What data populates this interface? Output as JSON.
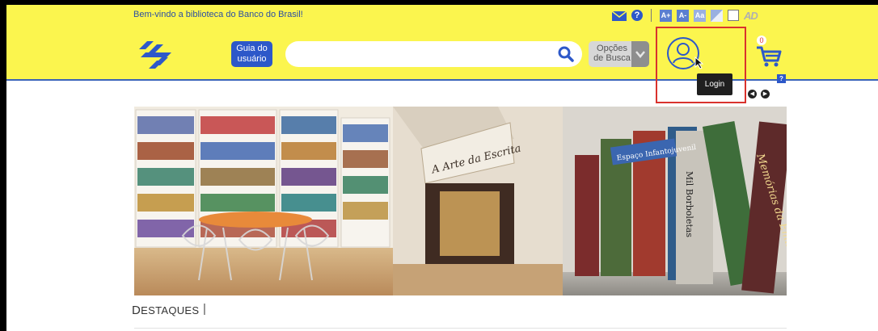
{
  "header": {
    "welcome_text": "Bem-vindo a biblioteca do Banco do Brasil!",
    "guia_label_1": "Guia do",
    "guia_label_2": "usuário",
    "search_placeholder": "",
    "opcoes_label_1": "Opções",
    "opcoes_label_2": "de Busca",
    "cart_count": "0",
    "login_tooltip": "Login"
  },
  "accessibility_tools": [
    {
      "label": "A+",
      "icon": "increase-font-icon"
    },
    {
      "label": "A-",
      "icon": "decrease-font-icon"
    },
    {
      "label": "Aa",
      "icon": "font-style-icon"
    },
    {
      "label": "",
      "icon": "contrast-icon"
    },
    {
      "label": "",
      "icon": "checkbox-icon"
    }
  ],
  "ad_logo": "AD",
  "sections": {
    "destaques_first": "D",
    "destaques_rest": "ESTAQUES",
    "separator": "|"
  },
  "banner": {
    "sign_text": "A Arte da Escrita",
    "book_1": "Espaço Infantojuvenil",
    "book_2": "Mil Borboletas",
    "book_3": "Memórias da Emília"
  },
  "colors": {
    "header_bg": "#fbf54e",
    "accent_blue": "#2d58c9",
    "highlight_red": "#d9322d"
  }
}
